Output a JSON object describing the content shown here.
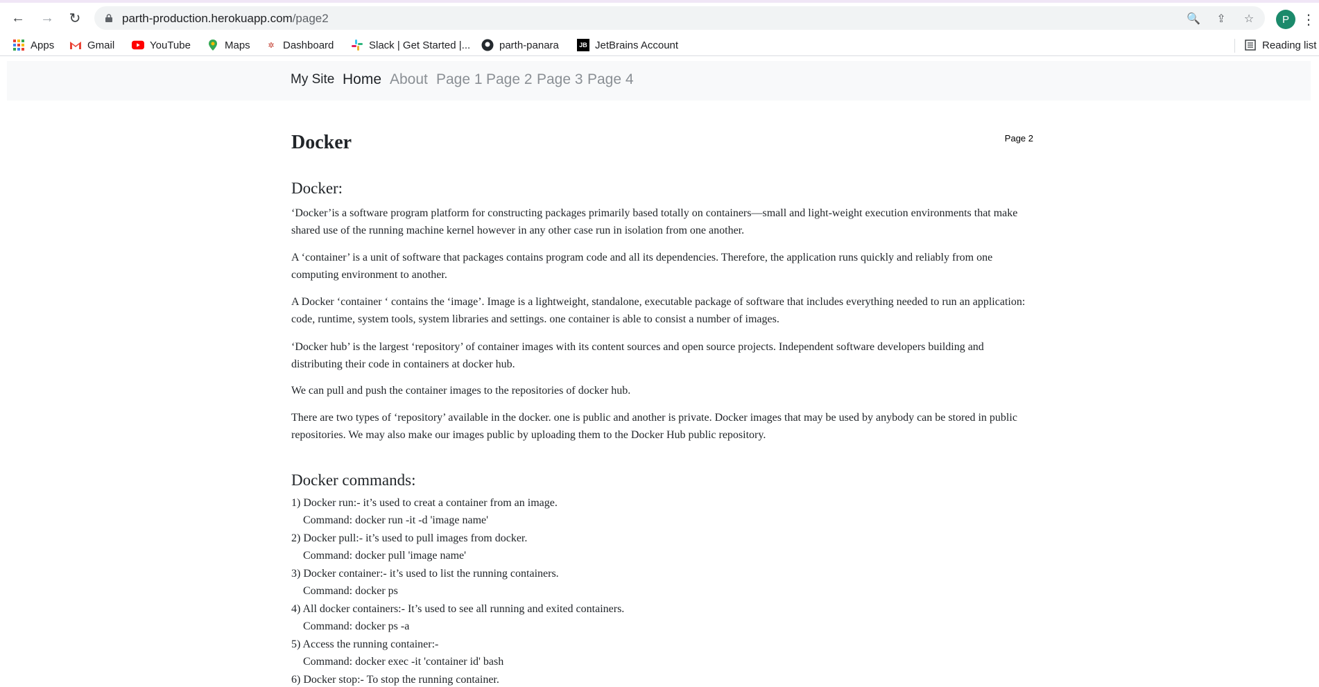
{
  "browser": {
    "url_host": "parth-production.herokuapp.com",
    "url_path": "/page2",
    "avatar_letter": "P",
    "bookmarks": [
      {
        "label": "Apps",
        "icon": "apps-grid-icon"
      },
      {
        "label": "Gmail",
        "icon": "gmail-icon"
      },
      {
        "label": "YouTube",
        "icon": "youtube-icon"
      },
      {
        "label": "Maps",
        "icon": "maps-icon"
      },
      {
        "label": "Dashboard",
        "icon": "dashboard-icon"
      },
      {
        "label": "Slack | Get Started |...",
        "icon": "slack-icon"
      },
      {
        "label": "parth-panara",
        "icon": "github-icon"
      },
      {
        "label": "JetBrains Account",
        "icon": "jetbrains-icon"
      }
    ],
    "reading_list": "Reading list"
  },
  "site_nav": {
    "brand": "My Site",
    "links": [
      "Home",
      "About",
      "Page 1",
      "Page 2",
      "Page 3",
      "Page 4"
    ]
  },
  "page": {
    "title": "Docker",
    "tag": "Page 2",
    "section1_heading": "Docker:",
    "paragraphs": [
      "‘Docker’is a software program platform for constructing packages primarily based totally on containers—small and light-weight execution environments that make shared use of the running machine kernel however in any other case run in isolation from one another.",
      "A ‘container’ is a unit of software that packages contains program code and all its dependencies. Therefore, the application runs quickly and reliably from one computing environment to another.",
      "A Docker ‘container ‘ contains the ‘image’. Image is a lightweight, standalone, executable package of software that includes everything needed to run an application: code, runtime, system tools, system libraries and settings. one container is able to consist a number of images.",
      "‘Docker hub’ is the largest ‘repository’ of container images with its content sources and open source projects. Independent software developers building and distributing their code in containers at docker hub.",
      "We can pull and push the container images to the repositories of docker hub.",
      "There are two types of ‘repository’ available in the docker. one is public and another is private. Docker images that may be used by anybody can be stored in public repositories. We may also make our images public by uploading them to the Docker Hub public repository."
    ],
    "section2_heading": "Docker commands:",
    "commands": [
      "1) Docker run:- it’s used to creat a container from an image.",
      "Command: docker run -it -d 'image name'",
      "2) Docker pull:- it’s used to pull images from docker.",
      "Command: docker pull 'image name'",
      "3) Docker container:- it’s used to list the running containers.",
      "Command: docker ps",
      "4) All docker containers:- It’s used to see all running and exited containers.",
      "Command: docker ps -a",
      "5) Access the running container:-",
      "Command: docker exec -it 'container id' bash",
      "6) Docker stop:- To stop the running container."
    ]
  }
}
